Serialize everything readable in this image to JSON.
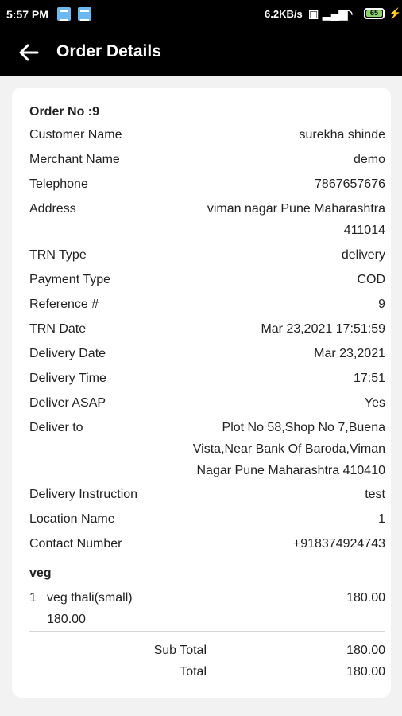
{
  "status_bar": {
    "time": "5:57 PM",
    "network_speed": "6.2KB/s",
    "battery_level": "65",
    "icons": [
      "notification-icon",
      "notification-icon",
      "vowifi-icon",
      "signal-icon",
      "wifi-icon",
      "battery-icon",
      "charging-icon"
    ]
  },
  "app_bar": {
    "title": "Order Details",
    "back_icon": "arrow-left-icon"
  },
  "order": {
    "order_no": "Order No :9",
    "fields": [
      {
        "label": "Customer Name",
        "value": "surekha shinde"
      },
      {
        "label": "Merchant Name",
        "value": "demo"
      },
      {
        "label": "Telephone",
        "value": "7867657676"
      },
      {
        "label": "Address",
        "value": "viman nagar Pune Maharashtra\n411014"
      },
      {
        "label": "TRN Type",
        "value": "delivery"
      },
      {
        "label": "Payment Type",
        "value": "COD"
      },
      {
        "label": "Reference #",
        "value": "9"
      },
      {
        "label": "TRN Date",
        "value": "Mar 23,2021 17:51:59"
      },
      {
        "label": "Delivery Date",
        "value": "Mar 23,2021"
      },
      {
        "label": "Delivery Time",
        "value": "17:51"
      },
      {
        "label": "Deliver ASAP",
        "value": "Yes"
      },
      {
        "label": "Deliver to",
        "value": "Plot No 58,Shop No 7,Buena\nVista,Near Bank Of Baroda,Viman\nNagar Pune Maharashtra 410410"
      },
      {
        "label": "Delivery Instruction",
        "value": "test"
      },
      {
        "label": "Location Name",
        "value": "1"
      },
      {
        "label": "Contact Number",
        "value": "+918374924743"
      }
    ]
  },
  "items": {
    "category": "veg",
    "list": [
      {
        "qty": "1",
        "name": "veg thali(small)",
        "price": "180.00",
        "unit_price": "180.00"
      }
    ]
  },
  "totals": {
    "sub_total_label": "Sub Total",
    "sub_total_value": "180.00",
    "total_label": "Total",
    "total_value": "180.00"
  }
}
